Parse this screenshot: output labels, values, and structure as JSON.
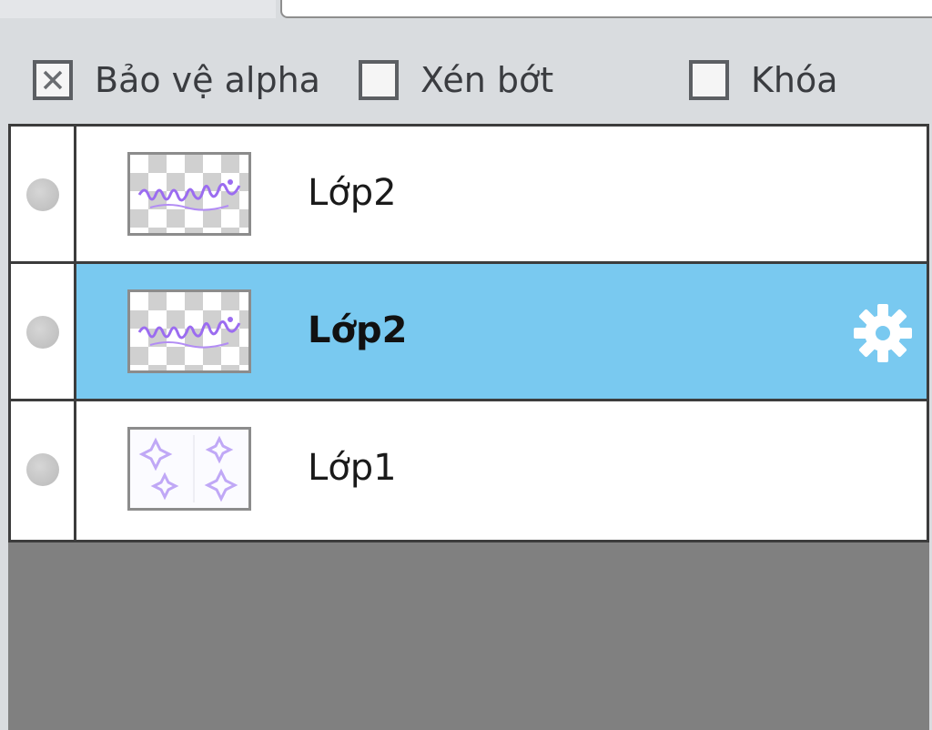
{
  "options": {
    "protect_alpha": {
      "label": "Bảo vệ alpha",
      "checked": true
    },
    "clipping": {
      "label": "Xén bớt",
      "checked": false
    },
    "lock": {
      "label": "Khóa",
      "checked": false
    }
  },
  "layers": [
    {
      "name": "Lớp2",
      "selected": false,
      "thumbnail": "lettering-on-transparent"
    },
    {
      "name": "Lớp2",
      "selected": true,
      "thumbnail": "lettering-on-transparent"
    },
    {
      "name": "Lớp1",
      "selected": false,
      "thumbnail": "sparkles"
    }
  ],
  "icons": {
    "visibility": "visibility-dot-icon",
    "settings": "gear-icon",
    "checkbox_mark": "x-mark-icon"
  },
  "colors": {
    "selection": "#79c9f0",
    "panel_bg": "#d9dcdf",
    "empty_area": "#808080",
    "thumbnail_ink": "#9b6cf0"
  }
}
